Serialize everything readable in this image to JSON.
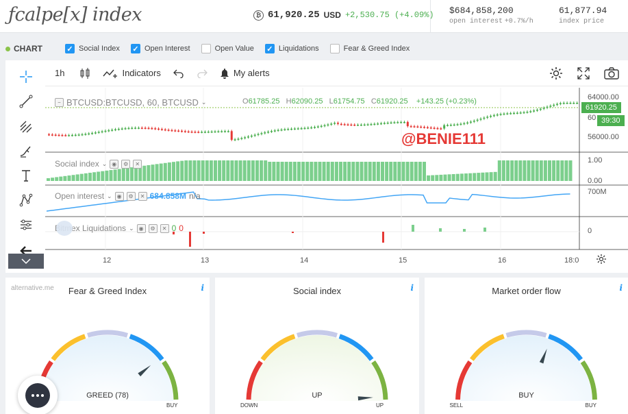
{
  "header": {
    "logo": "ƒcalpe[x] index",
    "ticker": {
      "symbol_icon": "bitcoin-icon",
      "price": "61,920.25",
      "currency": "USD",
      "change": "+2,530.75 (+4.09%)"
    },
    "open_interest": {
      "value": "$684,858,200",
      "label": "open interest",
      "change": "+0.7%/h"
    },
    "index_price": {
      "value": "61,877.94",
      "label": "index price"
    }
  },
  "chart_toggles": {
    "label": "CHART",
    "items": [
      {
        "label": "Social Index",
        "checked": true
      },
      {
        "label": "Open Interest",
        "checked": true
      },
      {
        "label": "Open Value",
        "checked": false
      },
      {
        "label": "Liquidations",
        "checked": true
      },
      {
        "label": "Fear & Greed Index",
        "checked": false
      }
    ]
  },
  "toolbar": {
    "interval": "1h",
    "indicators": "Indicators",
    "alerts": "My alerts"
  },
  "main_chart": {
    "symbol": "BTCUSD:BTCUSD, 60, BTCUSD",
    "o_label": "O",
    "o": "61785.25",
    "h_label": "H",
    "h": "62090.25",
    "l_label": "L",
    "l": "61754.75",
    "c_label": "C",
    "c": "61920.25",
    "chg": "+143.25 (+0.23%)",
    "price_tag": "61920.25",
    "countdown": "39:30",
    "watermark": "@BENIE111",
    "price_axis": [
      "64000.00",
      "60",
      "56000.00"
    ]
  },
  "social_pane": {
    "title": "Social index",
    "axis": [
      "1.00",
      "0.00"
    ]
  },
  "oi_pane": {
    "title": "Open interest",
    "value": "684.858M",
    "extra": "n/a",
    "axis": [
      "700M"
    ]
  },
  "liq_pane": {
    "title": "Bitmex Liquidations",
    "v1": "0",
    "v2": "0",
    "axis": [
      "0"
    ]
  },
  "time_axis": [
    "12",
    "13",
    "14",
    "15",
    "16",
    "18:0"
  ],
  "cards": [
    {
      "title": "Fear & Greed Index",
      "source": "alternative.me",
      "state": "GREED (78)",
      "min": "",
      "max": "BUY"
    },
    {
      "title": "Social index",
      "source": "",
      "state": "UP",
      "min": "DOWN",
      "max": "UP"
    },
    {
      "title": "Market order flow",
      "source": "",
      "state": "BUY",
      "min": "SELL",
      "max": "BUY"
    }
  ],
  "info_glyph": "i",
  "colors": {
    "up": "#4caf50",
    "down": "#e53935",
    "accent": "#2196f3",
    "oi_line": "#42a5f5",
    "social_bar": "#7ccf8d"
  }
}
